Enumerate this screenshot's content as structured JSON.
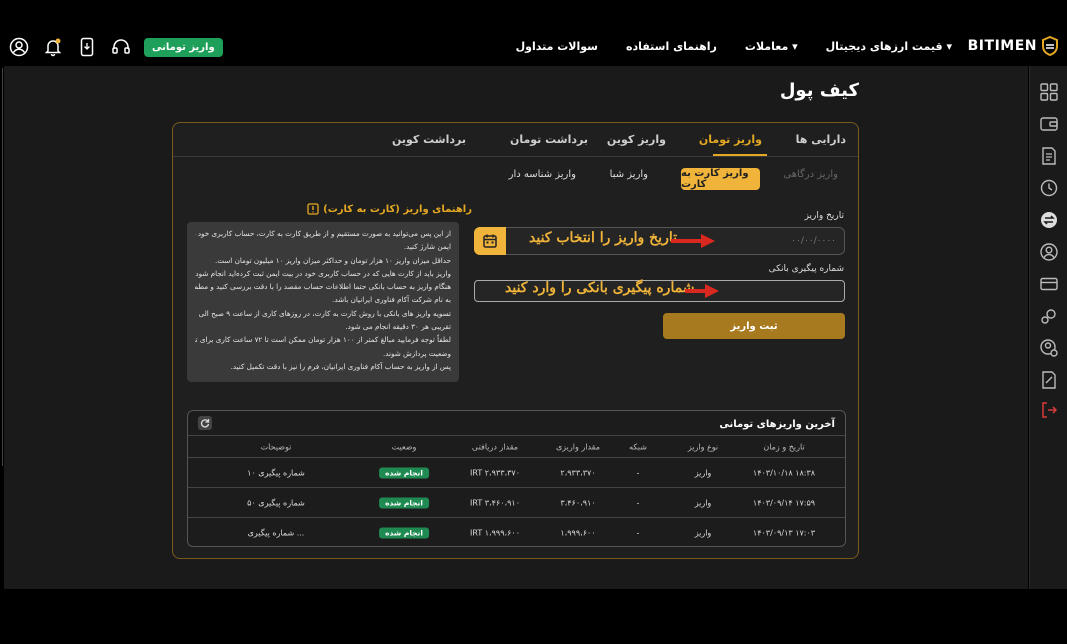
{
  "header": {
    "brand": "BITIMEN",
    "nav": [
      "قیمت ارزهای دیجیتال ▾",
      "معاملات ▾",
      "راهنمای استفاده",
      "سوالات متداول"
    ],
    "deposit_button": "واریز تومانی"
  },
  "page": {
    "title": "کیف پول"
  },
  "tabs": [
    "دارایی ها",
    "واریز تومان",
    "واریز کوین",
    "برداشت تومان",
    "برداشت کوین"
  ],
  "active_tab": "واریز تومان",
  "subtabs": [
    "واریز درگاهی",
    "واریز کارت به کارت",
    "واریز شبا",
    "واریز شناسه دار"
  ],
  "form": {
    "date_label": "تاریخ واریز",
    "date_placeholder": "۰۰/۰۰/۰۰۰۰",
    "tracking_label": "شماره پیگیری بانکی",
    "submit_label": "ثبت واریز",
    "annotation_date": "تاریخ واریز را انتخاب کنید",
    "annotation_tracking": "شماره پیگیری بانکی را وارد کنید"
  },
  "guide": {
    "title": "راهنمای واریز (کارت به کارت)",
    "lines": [
      "از این پس می‌توانید به صورت مستقیم و از طریق کارت به کارت، حساب کاربری خود را در بیت",
      "ایمن شارژ کنید.",
      "حداقل میزان واریز ۱۰ هزار تومان و حداکثر میزان واریز ۱۰ میلیون تومان است.",
      "واریز باید از کارت هایی که در حساب کاربری خود در بیت ایمن ثبت کرده‌اید انجام شود.",
      "هنگام واریز به حساب بانکی حتما اطلاعات حساب مقصد را با دقت بررسی کنید و مطمئن شوید",
      "به نام شرکت آکام فناوری ایرانیان باشد.",
      "تسویه واریز های بانکی با روش کارت به کارت، در روزهای کاری از ساعت ۹ صبح الی ۲۱، به صورت",
      "تقریبی هر ۳۰ دقیقه انجام می شود.",
      "لطفاً توجه فرمایید مبالغ کمتر از ۱۰۰ هزار تومان ممکن است تا ۷۲ ساعت کاری برای تعیین",
      "وضعیت پردازش شوند.",
      "پس از واریز به حساب آکام فناوری ایرانیان، فرم را نیز با دقت تکمیل کنید."
    ]
  },
  "history": {
    "title": "آخرین واریزهای تومانی",
    "columns": [
      "تاریخ و زمان",
      "نوع واریز",
      "شبکه",
      "مقدار واریزی",
      "مقدار دریافتی",
      "وضعیت",
      "توضیحات"
    ],
    "rows": [
      [
        "۱۴۰۳/۱۰/۱۸ ۱۸:۳۸",
        "واریز",
        "-",
        "۲،۹۳۳،۳۷۰",
        "IRT ۲،۹۳۳،۳۷۰",
        "انجام شده",
        "شماره پیگیری ۱۰"
      ],
      [
        "۱۴۰۳/۰۹/۱۴ ۱۷:۵۹",
        "واریز",
        "-",
        "۳،۴۶۰،۹۱۰",
        "IRT ۳،۴۶۰،۹۱۰",
        "انجام شده",
        "شماره پیگیری ۵۰"
      ],
      [
        "۱۴۰۳/۰۹/۱۳ ۱۷:۰۳",
        "واریز",
        "-",
        "۱،۹۹۹،۶۰۰",
        "IRT ۱،۹۹۹،۶۰۰",
        "انجام شده",
        "شماره پیگیری ..."
      ]
    ]
  },
  "colors": {
    "accent": "#e5a823",
    "success": "#1f8a52",
    "border": "#7a5a1e"
  },
  "icons": [
    "profile-icon",
    "bell-icon",
    "phone-icon",
    "headset-icon",
    "calendar-icon",
    "refresh-icon",
    "guide-icon"
  ]
}
